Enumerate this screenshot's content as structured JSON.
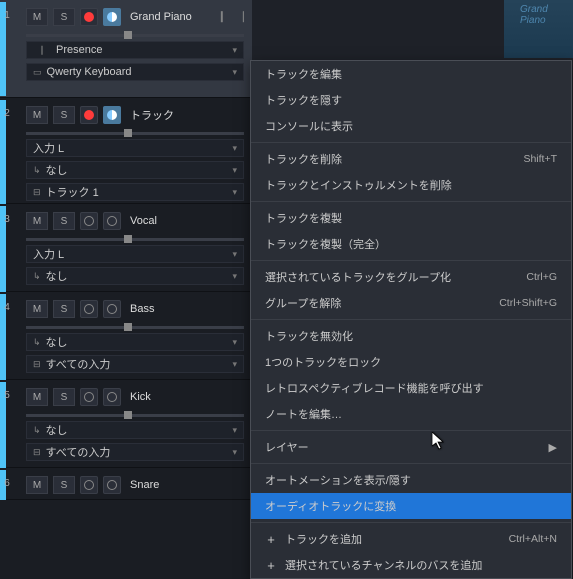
{
  "tracks": [
    {
      "num": "1",
      "name": "Grand Piano",
      "color": "#4fc3f7",
      "inputs": [
        "Presence",
        "Qwerty Keyboard"
      ],
      "inst": true
    },
    {
      "num": "2",
      "name": "トラック",
      "color": "#4fc3f7",
      "inputs": [
        "入力 L",
        "なし",
        "トラック 1"
      ]
    },
    {
      "num": "3",
      "name": "Vocal",
      "color": "#4fc3f7",
      "inputs": [
        "入力 L",
        "なし"
      ]
    },
    {
      "num": "4",
      "name": "Bass",
      "color": "#4fc3f7",
      "inputs": [
        "なし",
        "すべての入力"
      ]
    },
    {
      "num": "5",
      "name": "Kick",
      "color": "#4fc3f7",
      "inputs": [
        "なし",
        "すべての入力"
      ]
    },
    {
      "num": "6",
      "name": "Snare",
      "color": "#4fc3f7",
      "inputs": []
    }
  ],
  "btns": {
    "mute": "M",
    "solo": "S"
  },
  "clip": {
    "name": "Grand Piano"
  },
  "menu": {
    "groups": [
      [
        {
          "t": "トラックを編集"
        },
        {
          "t": "トラックを隠す"
        },
        {
          "t": "コンソールに表示"
        }
      ],
      [
        {
          "t": "トラックを削除",
          "s": "Shift+T"
        },
        {
          "t": "トラックとインストゥルメントを削除"
        }
      ],
      [
        {
          "t": "トラックを複製"
        },
        {
          "t": "トラックを複製（完全）"
        }
      ],
      [
        {
          "t": "選択されているトラックをグループ化",
          "s": "Ctrl+G"
        },
        {
          "t": "グループを解除",
          "s": "Ctrl+Shift+G",
          "d": true
        }
      ],
      [
        {
          "t": "トラックを無効化"
        },
        {
          "t": "1つのトラックをロック"
        },
        {
          "t": "レトロスペクティブレコード機能を呼び出す",
          "d": true
        },
        {
          "t": "ノートを編集…"
        }
      ],
      [
        {
          "t": "レイヤー",
          "sub": true
        }
      ],
      [
        {
          "t": "オートメーションを表示/隠す"
        },
        {
          "t": "オーディオトラックに変換",
          "h": true
        }
      ],
      [
        {
          "t": "トラックを追加",
          "s": "Ctrl+Alt+N",
          "i": "+"
        },
        {
          "t": "選択されているチャンネルのバスを追加",
          "i": "+"
        }
      ]
    ]
  }
}
